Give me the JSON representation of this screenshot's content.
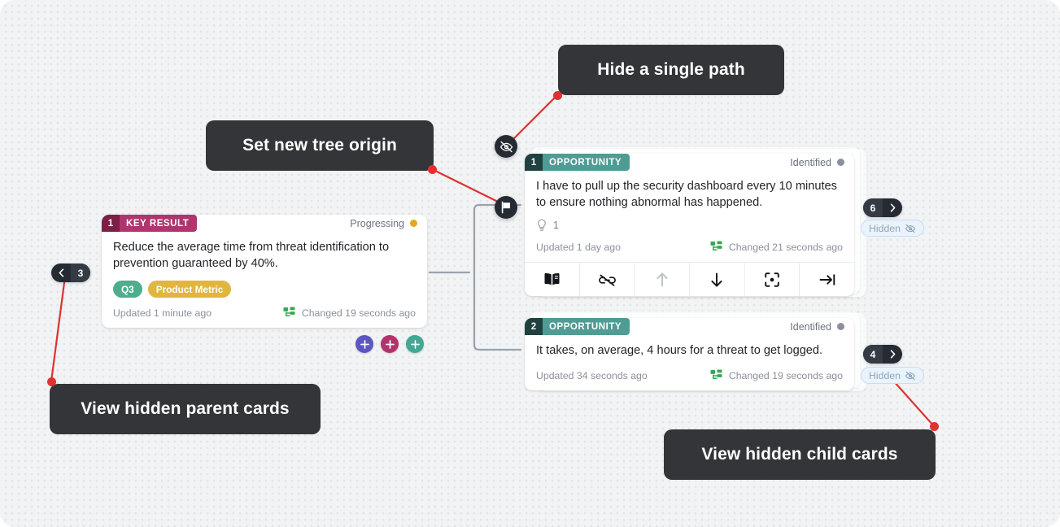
{
  "canvas": {
    "background_color": "#f1f3f4",
    "dot_color": "#e2e5e8"
  },
  "tooltips": [
    {
      "id": "hide-single-path",
      "label": "Hide a single path"
    },
    {
      "id": "set-new-tree-origin",
      "label": "Set new tree origin"
    },
    {
      "id": "view-hidden-parents",
      "label": "View hidden parent cards"
    },
    {
      "id": "view-hidden-children",
      "label": "View hidden child cards"
    }
  ],
  "tooltip_accent_color": "#e03131",
  "cards": {
    "key_result": {
      "badge_number": "1",
      "badge_label": "KEY RESULT",
      "badge_number_color": "#7b1f47",
      "badge_label_color": "#b0356e",
      "status_label": "Progressing",
      "status_color": "#e3a81d",
      "title": "Reduce the average time from threat identification to prevention guaranteed by 40%.",
      "tags": [
        {
          "label": "Q3",
          "color": "#4cae8c"
        },
        {
          "label": "Product Metric",
          "color": "#e0b63f"
        }
      ],
      "updated_label": "Updated 1 minute ago",
      "changed_label": "Changed 19 seconds ago"
    },
    "opportunity_1": {
      "badge_number": "1",
      "badge_label": "OPPORTUNITY",
      "badge_number_color": "#20413f",
      "badge_label_color": "#4e9c93",
      "status_label": "Identified",
      "status_color": "#8b9099",
      "title": "I have to pull up the security dashboard every 10 minutes to ensure nothing abnormal has happened.",
      "ideas_count": "1",
      "updated_label": "Updated 1 day ago",
      "changed_label": "Changed 21 seconds ago",
      "actions": [
        {
          "id": "open-book",
          "icon": "book-icon",
          "enabled": true
        },
        {
          "id": "unlink",
          "icon": "broken-link-icon",
          "enabled": true
        },
        {
          "id": "move-up",
          "icon": "arrow-up-icon",
          "enabled": false
        },
        {
          "id": "move-down",
          "icon": "arrow-down-icon",
          "enabled": true
        },
        {
          "id": "focus",
          "icon": "focus-target-icon",
          "enabled": true
        },
        {
          "id": "set-origin",
          "icon": "arrow-to-line-icon",
          "enabled": true
        }
      ]
    },
    "opportunity_2": {
      "badge_number": "2",
      "badge_label": "OPPORTUNITY",
      "badge_number_color": "#20413f",
      "badge_label_color": "#4e9c93",
      "status_label": "Identified",
      "status_color": "#8b9099",
      "title": "It takes, on average, 4 hours for a threat to get logged.",
      "updated_label": "Updated 34 seconds ago",
      "changed_label": "Changed 19 seconds ago"
    }
  },
  "hidden_parents": {
    "count": "3",
    "chevron": "chevron-left-icon"
  },
  "hidden_children_1": {
    "count": "6",
    "chevron": "chevron-right-icon",
    "hidden_label": "Hidden"
  },
  "hidden_children_2": {
    "count": "4",
    "chevron": "chevron-right-icon",
    "hidden_label": "Hidden"
  },
  "round_buttons": [
    {
      "id": "hide-path-button",
      "icon": "eye-slash-icon"
    },
    {
      "id": "set-tree-origin-button",
      "icon": "flag-icon"
    }
  ],
  "add_buttons": [
    {
      "id": "add-solution",
      "color": "#5c57c0"
    },
    {
      "id": "add-opportunity",
      "color": "#b3336b"
    },
    {
      "id": "add-idea",
      "color": "#42a795"
    }
  ]
}
